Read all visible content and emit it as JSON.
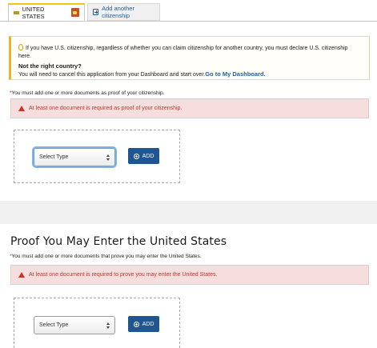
{
  "tabs": {
    "active_label": "UNITED STATES",
    "add_label": "Add another citizenship"
  },
  "info": {
    "line1": "If you have U.S. citizenship, regardless of whether you can claim citizenship for another country, you must declare U.S. citizenship here.",
    "heading": "Not the right country?",
    "line2": "You will need to cancel this application from your Dashboard and start over.",
    "link": "Go to My Dashboard."
  },
  "citizenship": {
    "req_star": "*",
    "req_text": "You must add one or more documents as proof of your citizenship.",
    "alert": "At least one document is required as proof of your citizenship.",
    "select_value": "Select Type",
    "add_label": "ADD"
  },
  "entry": {
    "title": "Proof You May Enter the United States",
    "req_star": "*",
    "req_text": "You must add one or more documents that prove you may enter the United States.",
    "alert": "At least one document is required to prove you may enter the United States.",
    "select_value": "Select Type",
    "add_label": "ADD"
  }
}
